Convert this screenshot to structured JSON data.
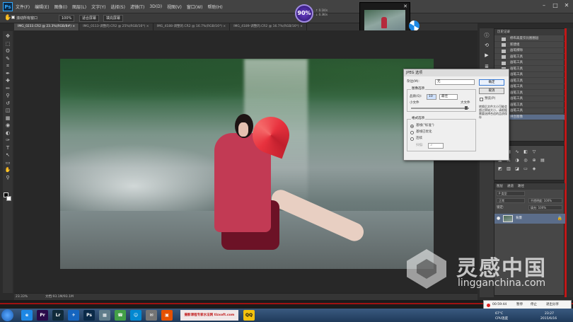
{
  "app": {
    "logo": "Ps",
    "menu": [
      "文件(F)",
      "编辑(E)",
      "图像(I)",
      "图层(L)",
      "文字(Y)",
      "选择(S)",
      "滤镜(T)",
      "3D(D)",
      "视图(V)",
      "窗口(W)",
      "帮助(H)"
    ]
  },
  "window_controls": [
    "–",
    "□",
    "✕"
  ],
  "options_bar": {
    "tool_icon": "hand-icon",
    "checkbox_label": "滚动所有窗口",
    "zoom": "100%",
    "fit_screen": "适合屏幕",
    "fill_screen": "填充屏幕"
  },
  "gauge": {
    "value": "90%",
    "up": "↑ 0.1K/s",
    "down": "↓ 0.3K/s"
  },
  "tabs": [
    {
      "label": "IMG_0233.CR2 @ 23.3%(RGB/8#) ×",
      "active": true
    },
    {
      "label": "IMG_0113-调整的.CR2 @ 25%(RGB/16*) ×",
      "active": false
    },
    {
      "label": "IMG_4188-调整的.CR2 @ 16.7%(RGB/16*) ×",
      "active": false
    },
    {
      "label": "IMG_4189-调整的.CR2 @ 16.7%(RGB/16*) ×",
      "active": false
    }
  ],
  "toolbar_icons": [
    "move-icon",
    "marquee-icon",
    "lasso-icon",
    "quick-select-icon",
    "crop-icon",
    "eyedropper-icon",
    "healing-icon",
    "brush-icon",
    "stamp-icon",
    "history-brush-icon",
    "eraser-icon",
    "gradient-icon",
    "blur-icon",
    "dodge-icon",
    "pen-icon",
    "type-icon",
    "path-select-icon",
    "shape-icon",
    "hand-icon",
    "zoom-icon"
  ],
  "toolbar_glyphs": [
    "✥",
    "⬚",
    "ʘ",
    "✎",
    "⌗",
    "✒",
    "✚",
    "✏",
    "⚲",
    "↺",
    "◫",
    "▦",
    "◉",
    "◐",
    "✑",
    "T",
    "↖",
    "▭",
    "✋",
    "⚲"
  ],
  "status": {
    "zoom": "23.33%",
    "doc": "文档:93.1M/93.1M"
  },
  "history": {
    "title": "历史记录",
    "items": [
      {
        "label": "修布高度仅比图图层",
        "selected": false
      },
      {
        "label": "新建组",
        "selected": false
      },
      {
        "label": "画笔擦除",
        "selected": false
      },
      {
        "label": "画笔工具",
        "selected": false
      },
      {
        "label": "画笔工具",
        "selected": false
      },
      {
        "label": "画笔工具",
        "selected": false
      },
      {
        "label": "画笔工具",
        "selected": false
      },
      {
        "label": "画笔工具",
        "selected": false
      },
      {
        "label": "画笔工具",
        "selected": false
      },
      {
        "label": "画笔工具",
        "selected": false
      },
      {
        "label": "画笔工具",
        "selected": false
      },
      {
        "label": "画笔工具",
        "selected": false
      },
      {
        "label": "画笔工具",
        "selected": false
      },
      {
        "label": "拼合图像",
        "selected": true
      }
    ]
  },
  "layers": {
    "tabs": [
      "图层",
      "通道",
      "路径"
    ],
    "filter": "P 类型",
    "blend": "正常",
    "opacity": "不透明度: 100%",
    "lock": "锁定:",
    "fill": "填充: 100%",
    "layer_name": "背景",
    "lock_icon": "🔒",
    "eye": "●"
  },
  "dialog": {
    "title": "JPEG 选项",
    "matte_label": "杂边(M):",
    "matte_value": "无",
    "image_options": "图像选项",
    "quality_label": "品质(Q):",
    "quality_value": "10",
    "quality_preset": "最佳",
    "small_file": "小文件",
    "large_file": "大文件",
    "format_options": "格式选项",
    "baseline_std": "基线(\"标准\")",
    "baseline_opt": "基线已优化",
    "progressive": "连续",
    "scan_label": "扫描:",
    "scan_value": "3",
    "ok": "确定",
    "cancel": "取消",
    "preview": "预览(P)",
    "note": "转换后文件大小可能会超过原始大小，请根据需要选择合适的品质保存"
  },
  "watermark": {
    "cn": "灵感中国",
    "en": "lingganchina.com"
  },
  "recorder": {
    "time": "00:59:44",
    "btn1": "暂停",
    "btn2": "停止",
    "btn3": "退出分享"
  },
  "taskbar": {
    "apps": [
      {
        "label": "e",
        "color": "#1e88e5"
      },
      {
        "label": "Pr",
        "color": "#2a0a4a"
      },
      {
        "label": "Lr",
        "color": "#102a3a"
      },
      {
        "label": "✈",
        "color": "#1565c0"
      },
      {
        "label": "Ps",
        "color": "#0b2a48"
      },
      {
        "label": "▦",
        "color": "#607d8b"
      },
      {
        "label": "☎",
        "color": "#43a047"
      },
      {
        "label": "☺",
        "color": "#0288d1"
      },
      {
        "label": "✉",
        "color": "#757575"
      },
      {
        "label": "▣",
        "color": "#e65100"
      }
    ],
    "banner": "摄影课程专家水法网 tlzxoft.com",
    "qq": "QQ",
    "tray_temp": "67°C",
    "tray_cpu": "CPU温度",
    "time": "23:27",
    "date": "2015/6/16"
  }
}
